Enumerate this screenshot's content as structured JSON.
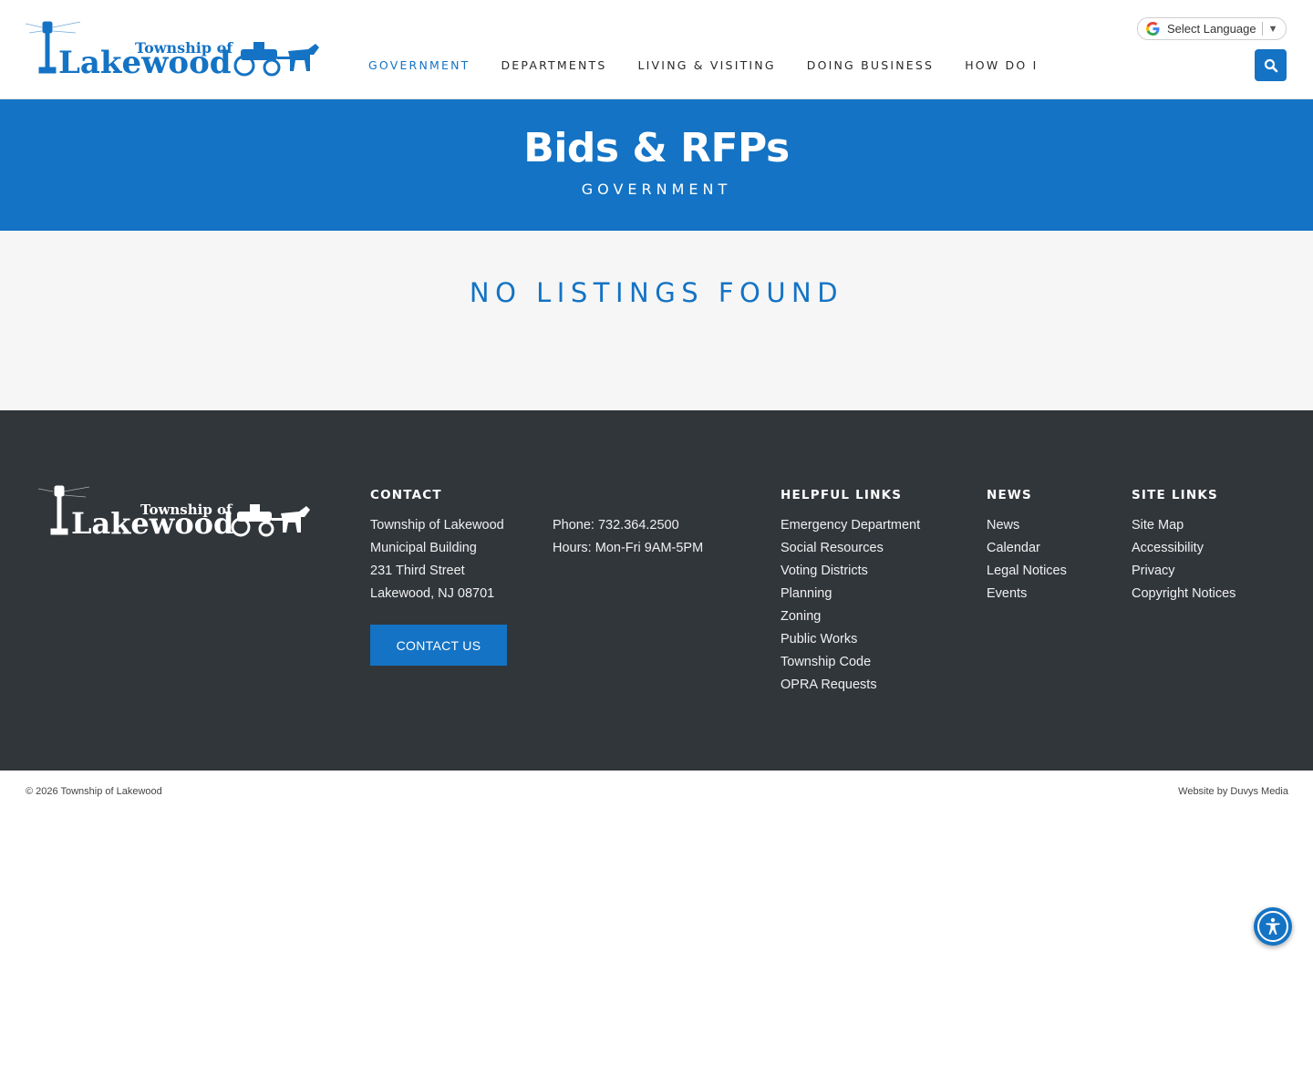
{
  "header": {
    "logo": {
      "line1": "Township of",
      "line2": "Lakewood"
    },
    "nav": [
      {
        "label": "GOVERNMENT",
        "active": true
      },
      {
        "label": "DEPARTMENTS",
        "active": false
      },
      {
        "label": "LIVING & VISITING",
        "active": false
      },
      {
        "label": "DOING BUSINESS",
        "active": false
      },
      {
        "label": "HOW DO I",
        "active": false
      }
    ],
    "language": {
      "label": "Select Language",
      "arrow": "▼"
    },
    "search_icon": "search-icon"
  },
  "hero": {
    "title": "Bids & RFPs",
    "subtitle": "GOVERNMENT"
  },
  "content": {
    "empty_message": "NO LISTINGS FOUND"
  },
  "footer": {
    "logo": {
      "line1": "Township of",
      "line2": "Lakewood"
    },
    "contact": {
      "heading": "CONTACT",
      "address": [
        "Township of Lakewood",
        "Municipal Building",
        "231 Third Street",
        "Lakewood, NJ 08701"
      ],
      "phone": "Phone: 732.364.2500",
      "hours": "Hours: Mon-Fri 9AM-5PM",
      "button": "CONTACT US"
    },
    "helpful_links": {
      "heading": "HELPFUL LINKS",
      "items": [
        "Emergency Department",
        "Social Resources",
        "Voting Districts",
        "Planning",
        "Zoning",
        "Public Works",
        "Township Code",
        "OPRA Requests"
      ]
    },
    "news": {
      "heading": "NEWS",
      "items": [
        "News",
        "Calendar",
        "Legal Notices",
        "Events"
      ]
    },
    "site_links": {
      "heading": "SITE LINKS",
      "items": [
        "Site Map",
        "Accessibility",
        "Privacy",
        "Copyright Notices"
      ]
    }
  },
  "bottom": {
    "copyright": "© 2026 Township of Lakewood",
    "credit": "Website by Duvys Media"
  },
  "colors": {
    "brand_blue": "#1473c4",
    "footer_bg": "#31363b",
    "content_bg": "#f6f6f6"
  }
}
